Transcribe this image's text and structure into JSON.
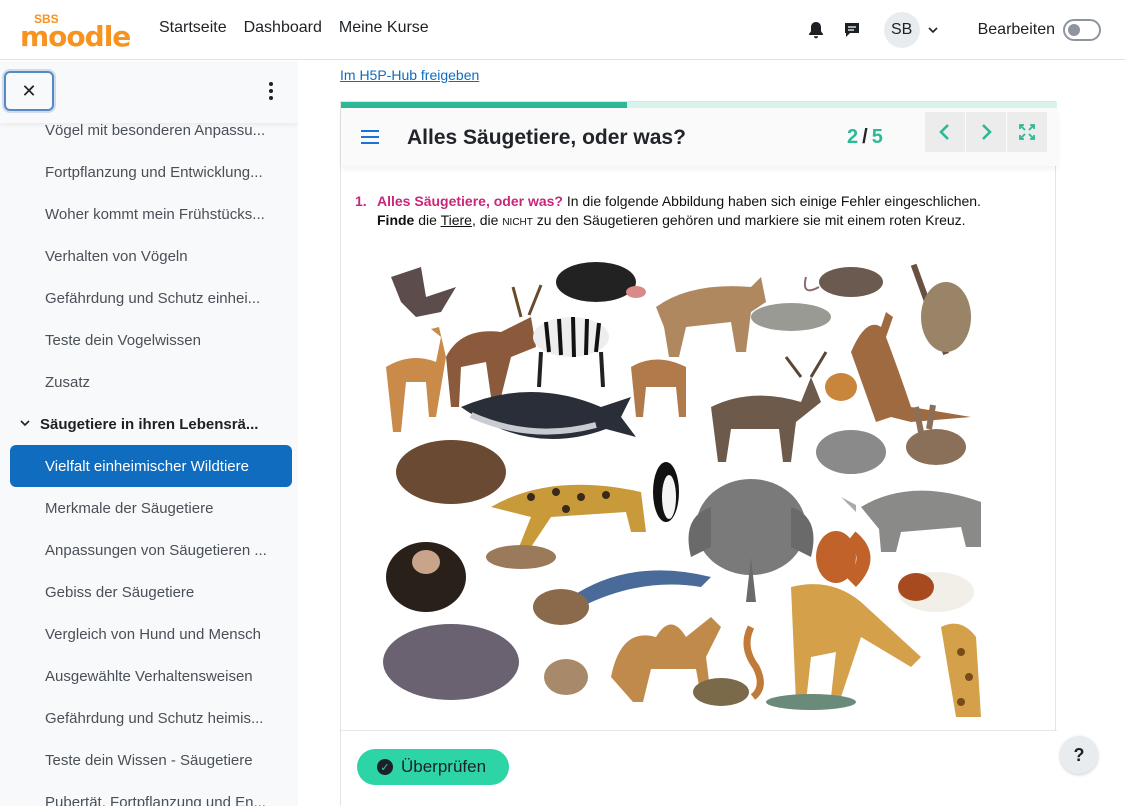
{
  "header": {
    "logo_small": "SBS",
    "logo_text": "moodle",
    "nav": [
      "Startseite",
      "Dashboard",
      "Meine Kurse"
    ],
    "avatar_initials": "SB",
    "edit_label": "Bearbeiten",
    "edit_mode_on": false
  },
  "drawer": {
    "close_symbol": "✕",
    "items": [
      {
        "label": "Vögel mit besonderen Anpassu...",
        "type": "item"
      },
      {
        "label": "Fortpflanzung und Entwicklung...",
        "type": "item"
      },
      {
        "label": "Woher kommt mein Frühstücks...",
        "type": "item"
      },
      {
        "label": "Verhalten von Vögeln",
        "type": "item"
      },
      {
        "label": "Gefährdung und Schutz einhei...",
        "type": "item"
      },
      {
        "label": "Teste dein Vogelwissen",
        "type": "item"
      },
      {
        "label": "Zusatz",
        "type": "item"
      },
      {
        "label": "Säugetiere in ihren Lebensrä...",
        "type": "section"
      },
      {
        "label": "Vielfalt einheimischer Wildtiere",
        "type": "active"
      },
      {
        "label": "Merkmale der Säugetiere",
        "type": "item"
      },
      {
        "label": "Anpassungen von Säugetieren ...",
        "type": "item"
      },
      {
        "label": "Gebiss der Säugetiere",
        "type": "item"
      },
      {
        "label": "Vergleich von Hund und Mensch",
        "type": "item"
      },
      {
        "label": "Ausgewählte Verhaltensweisen",
        "type": "item"
      },
      {
        "label": "Gefährdung und Schutz heimis...",
        "type": "item"
      },
      {
        "label": "Teste dein Wissen - Säugetiere",
        "type": "item"
      },
      {
        "label": "Pubertät, Fortpflanzung und En...",
        "type": "item"
      }
    ]
  },
  "main": {
    "share_link": "Im H5P-Hub freigeben",
    "presentation": {
      "title": "Alles Säugetiere, oder was?",
      "current_slide": "2",
      "separator": "/",
      "total_slides": "5",
      "progress_fraction": 0.4
    },
    "task": {
      "number": "1.",
      "heading": "Alles Säugetiere, oder was?",
      "line1_rest": " In die folgende Abbildung haben sich einige Fehler eingeschlichen.",
      "line2_bold": "Finde",
      "line2_a": " die ",
      "line2_underlined": "Tiere",
      "line2_b": ", die ",
      "line2_smallcaps": "NICHT",
      "line2_c": " zu den Säugetieren gehören und markiere sie mit einem roten Kreuz."
    },
    "check_button": "Überprüfen"
  },
  "help_label": "?",
  "colors": {
    "accent": "#0f6cbf",
    "h5p_green": "#2db896",
    "check_button": "#2dd4a6",
    "task_heading": "#c8267a",
    "cross": "#e0201e"
  }
}
